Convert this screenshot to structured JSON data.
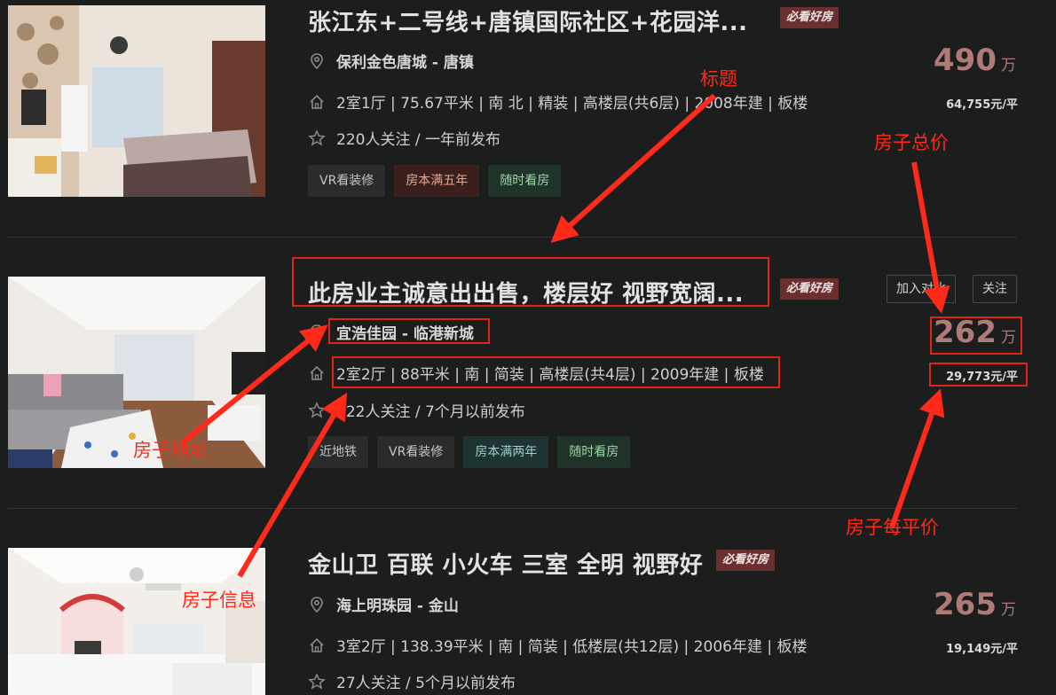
{
  "listings": [
    {
      "title": "张江东+二号线+唐镇国际社区+花园洋...",
      "badge": "必看好房",
      "address": "保利金色唐城 - 唐镇",
      "info": "2室1厅 | 75.67平米 | 南 北 | 精装 | 高楼层(共6层) | 2008年建 | 板楼",
      "follow": "220人关注 / 一年前发布",
      "tags": [
        "VR看装修",
        "房本满五年",
        "随时看房"
      ],
      "price": "490",
      "price_unit": "万",
      "unit_price": "64,755元/平"
    },
    {
      "title": "此房业主诚意出出售，楼层好 视野宽阔...",
      "badge": "必看好房",
      "address": "宜浩佳园 - 临港新城",
      "info": "2室2厅 | 88平米 | 南 | 简装 | 高楼层(共4层) | 2009年建 | 板楼",
      "follow": "122人关注 / 7个月以前发布",
      "tags": [
        "近地铁",
        "VR看装修",
        "房本满两年",
        "随时看房"
      ],
      "price": "262",
      "price_unit": "万",
      "unit_price": "29,773元/平",
      "buttons": {
        "compare": "加入对比",
        "follow": "关注"
      }
    },
    {
      "title": "金山卫 百联 小火车 三室 全明 视野好",
      "badge": "必看好房",
      "address": "海上明珠园 - 金山",
      "info": "3室2厅 | 138.39平米 | 南 | 简装 | 低楼层(共12层) | 2006年建 | 板楼",
      "follow": "27人关注 / 5个月以前发布",
      "price": "265",
      "price_unit": "万",
      "unit_price": "19,149元/平"
    }
  ],
  "annotations": {
    "title": "标题",
    "total_price": "房子总价",
    "address": "房子地址",
    "info": "房子信息",
    "unit_price": "房子每平价"
  },
  "colors": {
    "annotation": "#ff2a1a",
    "price": "#b07a77",
    "badge": "#6b2f2f",
    "background": "#1c1d1d"
  }
}
